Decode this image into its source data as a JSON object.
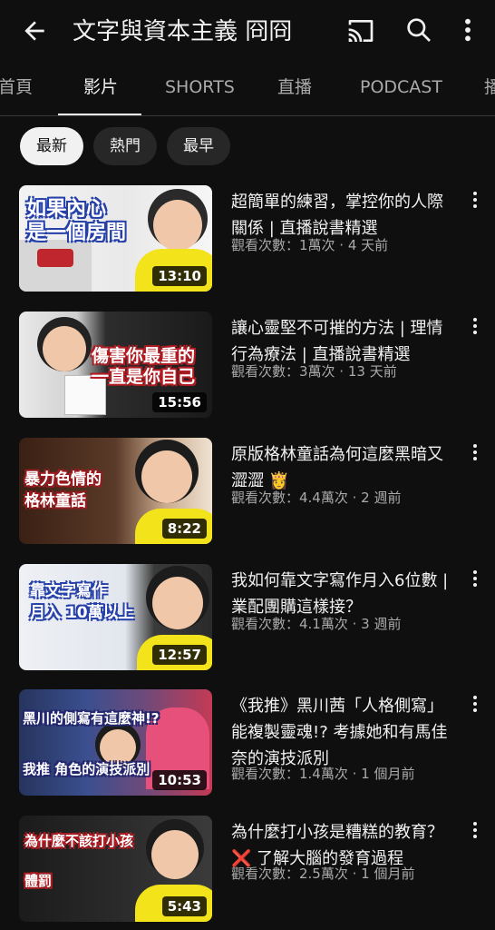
{
  "header": {
    "title": "文字與資本主義 冏冏",
    "icons": [
      "back-arrow-icon",
      "cast-icon",
      "search-icon",
      "more-vert-icon"
    ]
  },
  "tabs": [
    {
      "label": "首頁"
    },
    {
      "label": "影片"
    },
    {
      "label": "SHORTS"
    },
    {
      "label": "直播"
    },
    {
      "label": "PODCAST"
    },
    {
      "label": "播"
    }
  ],
  "filters": [
    {
      "label": "最新"
    },
    {
      "label": "熱門"
    },
    {
      "label": "最早"
    }
  ],
  "videos": [
    {
      "title": "超簡單的練習，掌控你的人際關係 | 直播說書精選",
      "meta": "觀看次數：1萬次 · 4 天前",
      "duration": "13:10",
      "thumb_caption": "如果內心\n是一個房間"
    },
    {
      "title": "讓心靈堅不可摧的方法 | 理情行為療法 | 直播說書精選",
      "meta": "觀看次數：3萬次 · 13 天前",
      "duration": "15:56",
      "thumb_caption": "傷害你最重的\n一直是你自己"
    },
    {
      "title": "原版格林童話為何這麼黑暗又澀澀 👸",
      "meta": "觀看次數：4.4萬次 · 2 週前",
      "duration": "8:22",
      "thumb_caption": "暴力色情的\n格林童話"
    },
    {
      "title": "我如何靠文字寫作月入6位數 | 業配團購這樣接？",
      "meta": "觀看次數：4.1萬次 · 3 週前",
      "duration": "12:57",
      "thumb_caption": "靠文字寫作\n月入 10萬以上"
    },
    {
      "title": "《我推》黑川茜「人格側寫」能複製靈魂!? 考據她和有馬佳奈的演技派別",
      "meta": "觀看次數：1.4萬次 · 1 個月前",
      "duration": "10:53",
      "thumb_caption": "黑川的側寫有這麼神!?\n我推 角色的演技派別"
    },
    {
      "title": "為什麼打小孩是糟糕的教育？ ❌ 了解大腦的發育過程",
      "meta": "觀看次數：2.5萬次 · 1 個月前",
      "duration": "5:43",
      "thumb_caption": "為什麼不該打小孩\n體罰"
    }
  ]
}
